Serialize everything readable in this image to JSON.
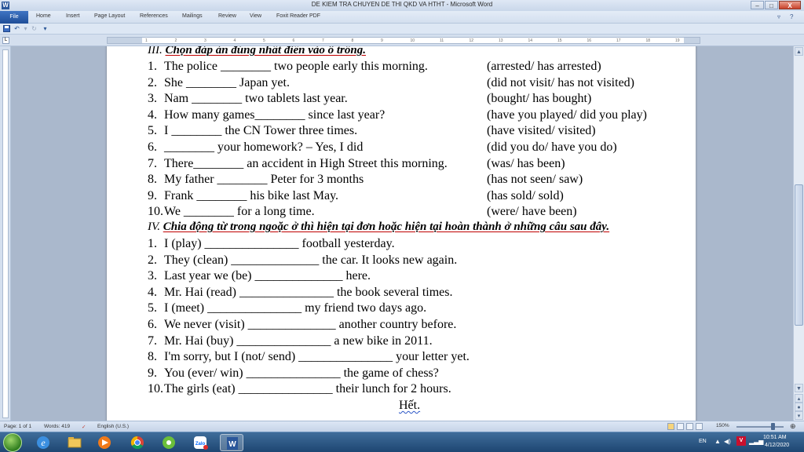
{
  "window": {
    "title": "DE KIEM TRA CHUYEN DE THI QKD VA HTHT - Microsoft Word",
    "app_icon": "W",
    "btn_min": "–",
    "btn_max": "□",
    "btn_close": "X"
  },
  "ribbon": {
    "tabs": [
      "File",
      "Home",
      "Insert",
      "Page Layout",
      "References",
      "Mailings",
      "Review",
      "View",
      "Foxit Reader PDF"
    ]
  },
  "ruler": {
    "ticks": [
      "1",
      "2",
      "3",
      "4",
      "5",
      "6",
      "7",
      "8",
      "9",
      "10",
      "11",
      "12",
      "13",
      "14",
      "15",
      "16",
      "17",
      "18",
      "19"
    ]
  },
  "document": {
    "section3": {
      "roman": "III.",
      "title": "Chọn đáp án đúng nhất điền vào ô trống.",
      "items": [
        {
          "num": "1.",
          "text": "The police ________ two people early this morning.",
          "choices": "(arrested/ has arrested)"
        },
        {
          "num": "2.",
          "text": "She ________ Japan yet.",
          "choices": "(did not visit/ has not visited)"
        },
        {
          "num": "3.",
          "text": "Nam ________ two tablets last year.",
          "choices": "(bought/ has bought)"
        },
        {
          "num": "4.",
          "text": "How many games________ since last year?",
          "choices": "(have you played/ did you play)"
        },
        {
          "num": "5.",
          "text": "I ________ the CN Tower three times.",
          "choices": "(have visited/ visited)"
        },
        {
          "num": "6.",
          "text": "________ your homework? – Yes, I did",
          "choices": "(did you do/ have you do)"
        },
        {
          "num": "7.",
          "text": "There________ an accident in High Street this morning.",
          "choices": "(was/ has been)"
        },
        {
          "num": "8.",
          "text": "My father ________ Peter for 3 months",
          "choices": "(has not seen/ saw)"
        },
        {
          "num": "9.",
          "text": "Frank ________ his bike last May.",
          "choices": "(has sold/ sold)"
        },
        {
          "num": "10.",
          "text": "We ________ for a long time.",
          "choices": "(were/ have been)"
        }
      ]
    },
    "section4": {
      "roman": "IV.",
      "title": "Chia động từ trong ngoặc ở thì hiện tại đơn hoặc hiện tại hoàn thành ở những câu sau đây.",
      "items": [
        {
          "num": "1.",
          "text": "I (play) _______________ football yesterday."
        },
        {
          "num": "2.",
          "text": "They (clean) ______________ the car. It looks new again."
        },
        {
          "num": "3.",
          "text": "Last year we (be) ______________ here."
        },
        {
          "num": "4.",
          "text": "Mr. Hai (read) _______________ the book several times."
        },
        {
          "num": "5.",
          "text": "I (meet) _______________ my friend two days ago."
        },
        {
          "num": "6.",
          "text": "We never (visit) ______________ another country before."
        },
        {
          "num": "7.",
          "text": "Mr. Hai (buy) _______________ a new bike in 2011."
        },
        {
          "num": "8.",
          "text": "I'm sorry, but I (not/ send) _______________ your letter yet."
        },
        {
          "num": "9.",
          "text": "You (ever/ win) _______________ the game of chess?"
        },
        {
          "num": "10.",
          "text": "The girls (eat) _______________ their lunch for 2 hours."
        }
      ]
    },
    "ending": "Hết."
  },
  "status": {
    "page": "Page: 1 of 1",
    "words": "Words: 419",
    "language": "English (U.S.)",
    "zoom": "150%"
  },
  "taskbar": {
    "lang": "EN",
    "time": "10:51 AM",
    "date": "4/12/2020"
  },
  "colors": {
    "word_blue": "#2b579a",
    "underline_red": "#c00000",
    "taskbar": "#1e4672"
  }
}
